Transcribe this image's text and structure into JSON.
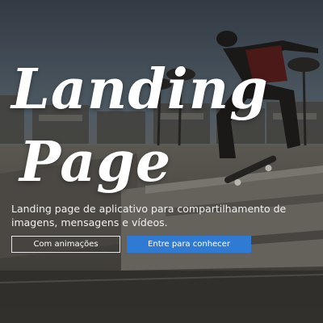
{
  "hero": {
    "title_line1": "Landing",
    "title_line2": "Page",
    "description": "Landing page de aplicativo para compartilhamento de imagens, mensagens e vídeos."
  },
  "buttons": {
    "secondary_label": "Com animações",
    "primary_label": "Entre para conhecer"
  },
  "colors": {
    "primary_button": "#2f7bd4",
    "text": "#ffffff",
    "overlay": "rgba(0,0,0,0.15)"
  }
}
